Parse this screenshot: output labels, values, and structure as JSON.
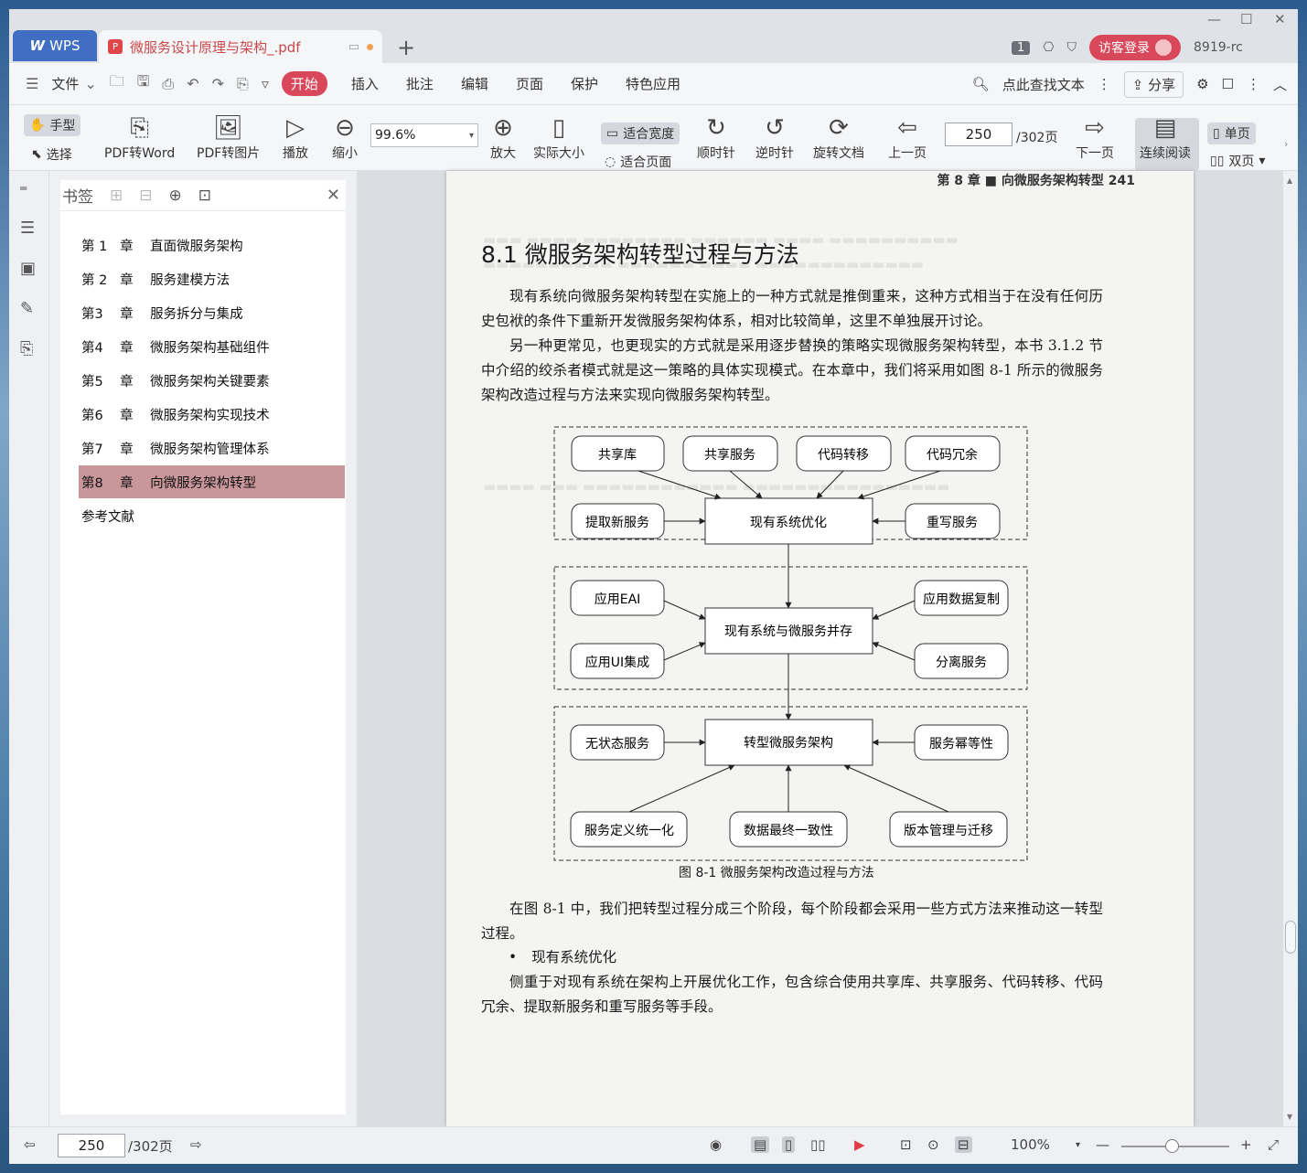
{
  "titlebar": {
    "app_tab": "WPS",
    "doc_tab": "微服务设计原理与架构_.pdf",
    "badge": "1",
    "login": "访客登录",
    "user": "8919-rc"
  },
  "menu": {
    "file": "文件",
    "items": [
      "开始",
      "插入",
      "批注",
      "编辑",
      "页面",
      "保护",
      "特色应用"
    ],
    "search": "点此查找文本",
    "share": "分享"
  },
  "ribbon": {
    "hand": "手型",
    "select": "选择",
    "pdf_word": "PDF转Word",
    "pdf_image": "PDF转图片",
    "play": "播放",
    "zoom_out": "缩小",
    "zoom_value": "99.6%",
    "zoom_in": "放大",
    "actual_size": "实际大小",
    "fit_width": "适合宽度",
    "fit_page": "适合页面",
    "clockwise": "顺时针",
    "counter_clockwise": "逆时针",
    "rotate_doc": "旋转文档",
    "prev_page": "上一页",
    "page_current": "250",
    "page_total": "/302页",
    "next_page": "下一页",
    "continuous": "连续阅读",
    "single": "单页",
    "double": "双页"
  },
  "panel": {
    "title": "书签",
    "bookmarks": [
      "第 1   章    直面微服务架构",
      "第 2   章    服务建模方法",
      "第3    章    服务拆分与集成",
      "第4    章    微服务架构基础组件",
      "第5    章    微服务架构关键要素",
      "第6    章    微服务架构实现技术",
      "第7    章    微服务架构管理体系",
      "第8    章    向微服务架构转型",
      "参考文献"
    ]
  },
  "page": {
    "header": "第 8 章 ■ 向微服务架构转型   241",
    "section_title": "8.1   微服务架构转型过程与方法",
    "para1": "现有系统向微服务架构转型在实施上的一种方式就是推倒重来，这种方式相当于在没有任何历史包袱的条件下重新开发微服务架构体系，相对比较简单，这里不单独展开讨论。",
    "para2": "另一种更常见，也更现实的方式就是采用逐步替换的策略实现微服务架构转型，本书 3.1.2 节中介绍的绞杀者模式就是这一策略的具体实现模式。在本章中，我们将采用如图 8-1 所示的微服务架构改造过程与方法来实现向微服务架构转型。",
    "diagram": {
      "stage1_center": "现有系统优化",
      "stage1_nodes": [
        "共享库",
        "共享服务",
        "代码转移",
        "代码冗余",
        "提取新服务",
        "重写服务"
      ],
      "stage2_center": "现有系统与微服务并存",
      "stage2_nodes": [
        "应用EAI",
        "应用数据复制",
        "应用UI集成",
        "分离服务"
      ],
      "stage3_center": "转型微服务架构",
      "stage3_nodes": [
        "无状态服务",
        "服务幂等性",
        "服务定义统一化",
        "数据最终一致性",
        "版本管理与迁移"
      ]
    },
    "caption": "图 8-1   微服务架构改造过程与方法",
    "para3": "在图 8-1 中，我们把转型过程分成三个阶段，每个阶段都会采用一些方式方法来推动这一转型过程。",
    "bullet": "现有系统优化",
    "para4": "侧重于对现有系统在架构上开展优化工作，包含综合使用共享库、共享服务、代码转移、代码冗余、提取新服务和重写服务等手段。"
  },
  "status": {
    "page_current": "250",
    "page_total": "/302页",
    "zoom": "100%"
  },
  "colors": {
    "accent": "#d9485a",
    "wps_blue": "#3f6ec3",
    "bookmark_active": "#c9969a"
  }
}
